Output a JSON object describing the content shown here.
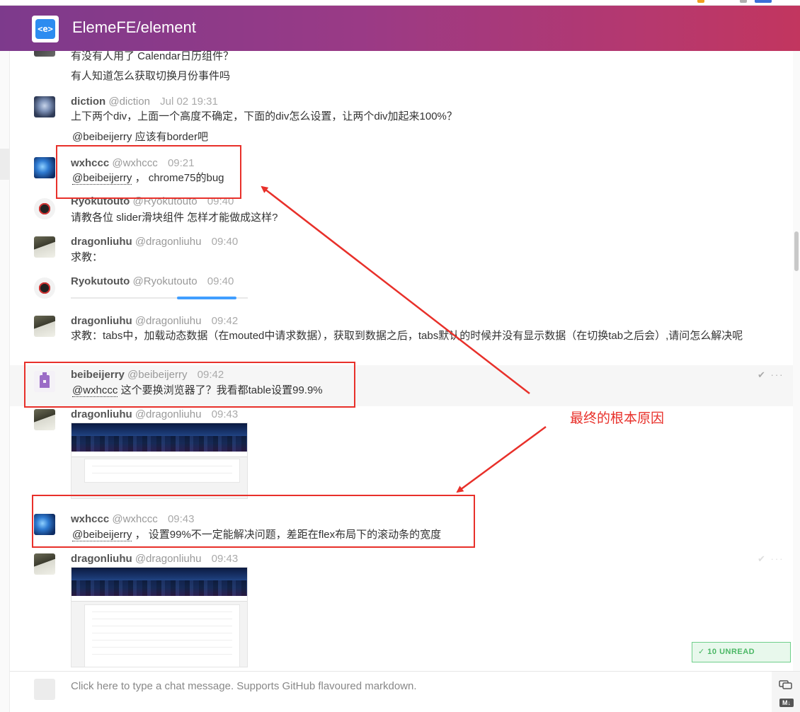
{
  "room": {
    "title": "ElemeFE/element",
    "logo_text": "<e>"
  },
  "messages": [
    {
      "continuation": true,
      "lines": [
        "有没有人用了 Calendar日历组件？",
        "有人知道怎么获取切换月份事件吗"
      ]
    },
    {
      "name": "diction",
      "handle": "@diction",
      "time": "Jul 02 19:31",
      "text": "上下两个div，上面一个高度不确定，下面的div怎么设置，让两个div加起来100%？",
      "reply_mention": "@beibeijerry",
      "reply_text": " 应该有border吧"
    },
    {
      "name": "wxhccc",
      "handle": "@wxhccc",
      "time": "09:21",
      "mention": "@beibeijerry",
      "text": " ， chrome75的bug"
    },
    {
      "name": "Ryokutouto",
      "handle": "@Ryokutouto",
      "time": "09:40",
      "text": "请教各位 slider滑块组件 怎样才能做成这样?"
    },
    {
      "name": "dragonliuhu",
      "handle": "@dragonliuhu",
      "time": "09:40",
      "text": "求教："
    },
    {
      "name": "Ryokutouto",
      "handle": "@Ryokutouto",
      "time": "09:40"
    },
    {
      "name": "dragonliuhu",
      "handle": "@dragonliuhu",
      "time": "09:42",
      "text": "求教：tabs中，加载动态数据（在mouted中请求数据），获取到数据之后，tabs默认的时候并没有显示数据（在切换tab之后会）,请问怎么解决呢"
    },
    {
      "name": "beibeijerry",
      "handle": "@beibeijerry",
      "time": "09:42",
      "mention": "@wxhccc",
      "text": " 这个要换浏览器了？我看都table设置99.9%",
      "actions": "✔ ···"
    },
    {
      "name": "dragonliuhu",
      "handle": "@dragonliuhu",
      "time": "09:43"
    },
    {
      "name": "wxhccc",
      "handle": "@wxhccc",
      "time": "09:43",
      "mention": "@beibeijerry",
      "text": " ， 设置99%不一定能解决问题，差距在flex布局下的滚动条的宽度"
    },
    {
      "name": "dragonliuhu",
      "handle": "@dragonliuhu",
      "time": "09:43",
      "actions": "✔ ···"
    }
  ],
  "annotation": {
    "text": "最终的根本原因",
    "color": "#e8302a"
  },
  "unread": {
    "label": "10 UNREAD",
    "icon": "chevron-down-icon"
  },
  "composer": {
    "placeholder": "Click here to type a chat message. Supports GitHub flavoured markdown.",
    "md_badge": "M↓"
  },
  "colors": {
    "header_start": "#7d3a8c",
    "header_end": "#c2365f",
    "accent": "#e8302a",
    "unread_green": "#4bb765"
  }
}
